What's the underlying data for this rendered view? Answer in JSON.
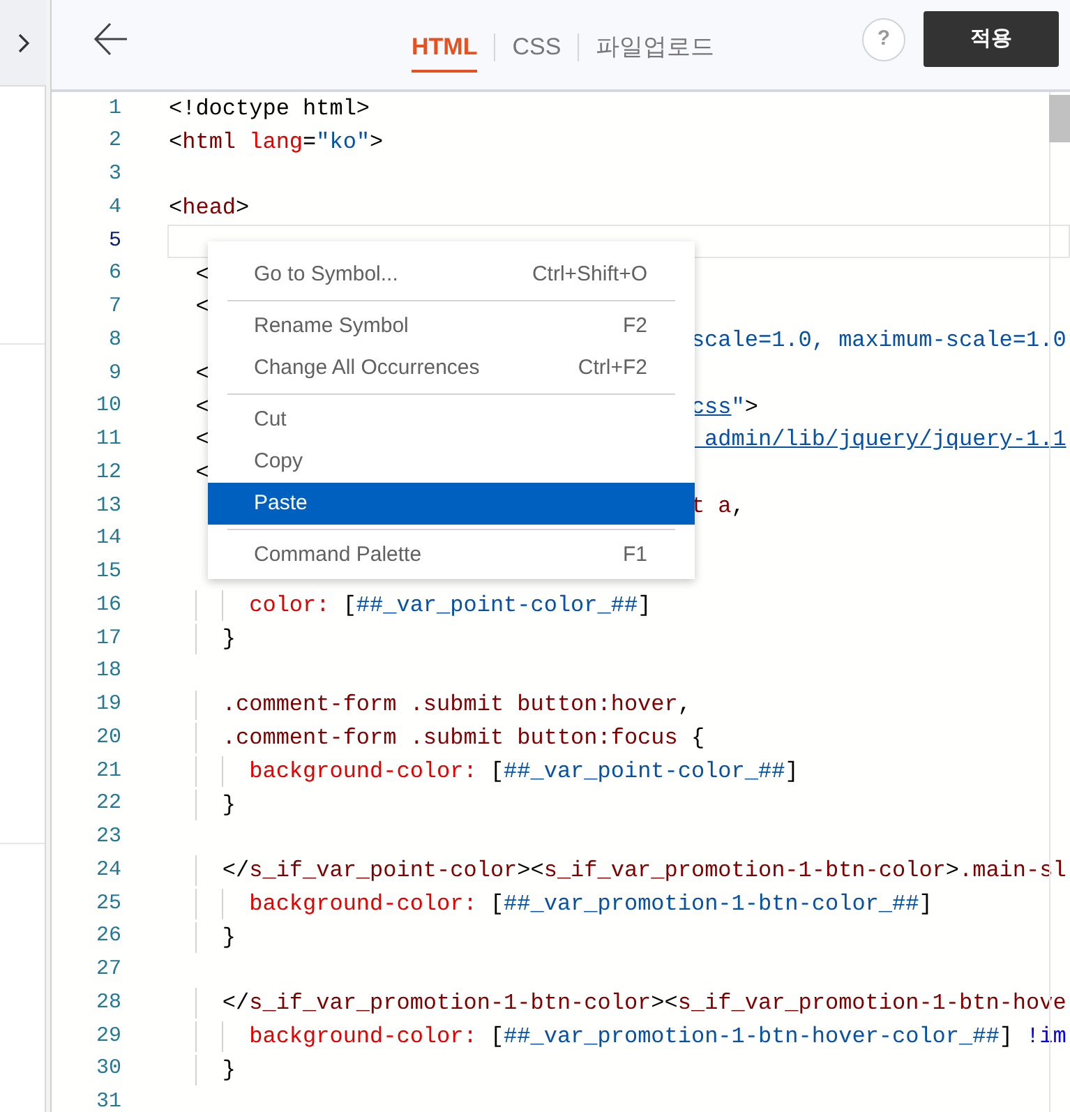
{
  "header": {
    "tabs": [
      {
        "label": "HTML",
        "selected": true
      },
      {
        "label": "CSS",
        "selected": false
      },
      {
        "label": "파일업로드",
        "selected": false
      }
    ],
    "help": "?",
    "apply_button": "적용"
  },
  "editor": {
    "lines": [
      {
        "number": "1",
        "current": false,
        "tokens": [
          {
            "kind": "plain",
            "text": "<!doctype html>"
          }
        ]
      },
      {
        "number": "2",
        "current": false,
        "tokens": [
          {
            "kind": "plain",
            "text": "<"
          },
          {
            "kind": "tag",
            "text": "html"
          },
          {
            "kind": "attr",
            "text": " lang"
          },
          {
            "kind": "plain",
            "text": "="
          },
          {
            "kind": "string",
            "text": "\"ko\""
          },
          {
            "kind": "plain",
            "text": ">"
          }
        ]
      },
      {
        "number": "3",
        "current": false
      },
      {
        "number": "4",
        "current": false,
        "tokens": [
          {
            "kind": "plain",
            "text": "<"
          },
          {
            "kind": "tag",
            "text": "head"
          },
          {
            "kind": "plain",
            "text": ">"
          }
        ]
      },
      {
        "number": "5",
        "current": true
      },
      {
        "number": "6",
        "current": false,
        "tokens": [
          {
            "kind": "plain",
            "text": "  <"
          }
        ]
      },
      {
        "number": "7",
        "current": false,
        "tokens": [
          {
            "kind": "plain",
            "text": "  <"
          }
        ]
      },
      {
        "number": "8",
        "current": false,
        "after": [
          {
            "kind": "string",
            "text": "scale=1.0, maximum-scale=1.0"
          }
        ]
      },
      {
        "number": "9",
        "current": false,
        "tokens": [
          {
            "kind": "plain",
            "text": "  <"
          }
        ]
      },
      {
        "number": "10",
        "current": false,
        "tokens": [
          {
            "kind": "plain",
            "text": "  <"
          }
        ],
        "after": [
          {
            "kind": "link",
            "text": "css"
          },
          {
            "kind": "string",
            "text": "\""
          },
          {
            "kind": "plain",
            "text": ">"
          }
        ]
      },
      {
        "number": "11",
        "current": false,
        "tokens": [
          {
            "kind": "plain",
            "text": "  <"
          }
        ],
        "after": [
          {
            "kind": "link",
            "text": "_admin/lib/jquery/jquery-1.1"
          }
        ]
      },
      {
        "number": "12",
        "current": false,
        "tokens": [
          {
            "kind": "plain",
            "text": "  <"
          }
        ]
      },
      {
        "number": "13",
        "current": false,
        "after": [
          {
            "kind": "selector",
            "text": "t a"
          },
          {
            "kind": "plain",
            "text": ","
          }
        ]
      },
      {
        "number": "14",
        "current": false
      },
      {
        "number": "15",
        "current": false
      },
      {
        "number": "16",
        "current": false,
        "tokens": [
          {
            "kind": "property",
            "text": "      color:"
          },
          {
            "kind": "plain",
            "text": " ["
          },
          {
            "kind": "value",
            "text": "##_var_point-color_##"
          },
          {
            "kind": "plain",
            "text": "]"
          }
        ]
      },
      {
        "number": "17",
        "current": false,
        "tokens": [
          {
            "kind": "plain",
            "text": "    }"
          }
        ]
      },
      {
        "number": "18",
        "current": false
      },
      {
        "number": "19",
        "current": false,
        "tokens": [
          {
            "kind": "selector",
            "text": "    .comment-form .submit button:hover"
          },
          {
            "kind": "plain",
            "text": ","
          }
        ]
      },
      {
        "number": "20",
        "current": false,
        "tokens": [
          {
            "kind": "selector",
            "text": "    .comment-form .submit button:focus"
          },
          {
            "kind": "plain",
            "text": " {"
          }
        ]
      },
      {
        "number": "21",
        "current": false,
        "tokens": [
          {
            "kind": "property",
            "text": "      background-color:"
          },
          {
            "kind": "plain",
            "text": " ["
          },
          {
            "kind": "value",
            "text": "##_var_point-color_##"
          },
          {
            "kind": "plain",
            "text": "]"
          }
        ]
      },
      {
        "number": "22",
        "current": false,
        "tokens": [
          {
            "kind": "plain",
            "text": "    }"
          }
        ]
      },
      {
        "number": "23",
        "current": false
      },
      {
        "number": "24",
        "current": false,
        "tokens": [
          {
            "kind": "plain",
            "text": "    </"
          },
          {
            "kind": "selector",
            "text": "s_if_var_point-color"
          },
          {
            "kind": "plain",
            "text": "><"
          },
          {
            "kind": "selector",
            "text": "s_if_var_promotion-1-btn-color"
          },
          {
            "kind": "plain",
            "text": ">"
          },
          {
            "kind": "selector",
            "text": ".main-sl"
          }
        ]
      },
      {
        "number": "25",
        "current": false,
        "tokens": [
          {
            "kind": "property",
            "text": "      background-color:"
          },
          {
            "kind": "plain",
            "text": " ["
          },
          {
            "kind": "value",
            "text": "##_var_promotion-1-btn-color_##"
          },
          {
            "kind": "plain",
            "text": "]"
          }
        ]
      },
      {
        "number": "26",
        "current": false,
        "tokens": [
          {
            "kind": "plain",
            "text": "    }"
          }
        ]
      },
      {
        "number": "27",
        "current": false
      },
      {
        "number": "28",
        "current": false,
        "tokens": [
          {
            "kind": "plain",
            "text": "    </"
          },
          {
            "kind": "selector",
            "text": "s_if_var_promotion-1-btn-color"
          },
          {
            "kind": "plain",
            "text": "><"
          },
          {
            "kind": "selector",
            "text": "s_if_var_promotion-1-btn-hove"
          }
        ]
      },
      {
        "number": "29",
        "current": false,
        "tokens": [
          {
            "kind": "property",
            "text": "      background-color:"
          },
          {
            "kind": "plain",
            "text": " ["
          },
          {
            "kind": "value",
            "text": "##_var_promotion-1-btn-hover-color_##"
          },
          {
            "kind": "plain",
            "text": "] "
          },
          {
            "kind": "keyword",
            "text": "!im"
          }
        ]
      },
      {
        "number": "30",
        "current": false,
        "tokens": [
          {
            "kind": "plain",
            "text": "    }"
          }
        ]
      },
      {
        "number": "31",
        "current": false
      }
    ]
  },
  "context_menu": {
    "groups": [
      [
        {
          "label": "Go to Symbol...",
          "shortcut": "Ctrl+Shift+O",
          "selected": false
        }
      ],
      [
        {
          "label": "Rename Symbol",
          "shortcut": "F2",
          "selected": false
        },
        {
          "label": "Change All Occurrences",
          "shortcut": "Ctrl+F2",
          "selected": false
        }
      ],
      [
        {
          "label": "Cut",
          "selected": false
        },
        {
          "label": "Copy",
          "selected": false
        },
        {
          "label": "Paste",
          "selected": true
        }
      ],
      [
        {
          "label": "Command Palette",
          "shortcut": "F1",
          "selected": false
        }
      ]
    ]
  }
}
